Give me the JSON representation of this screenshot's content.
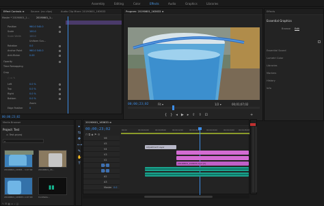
{
  "topnav": {
    "workspaces": [
      {
        "label": "Assembly",
        "active": false
      },
      {
        "label": "Editing",
        "active": false
      },
      {
        "label": "Color",
        "active": false
      },
      {
        "label": "Effects",
        "active": true
      },
      {
        "label": "Audio",
        "active": false
      },
      {
        "label": "Graphics",
        "active": false
      },
      {
        "label": "Libraries",
        "active": false
      }
    ]
  },
  "effect_controls": {
    "tabs": [
      {
        "label": "Effect Controls ≡",
        "active": true
      },
      {
        "label": "Source: (no clips)",
        "active": false
      },
      {
        "label": "Audio Clip Mixer: 20190601_163633",
        "active": false
      }
    ],
    "master_label": "Master * 20190601_1...",
    "sequence_label": "20190601_1...",
    "rows": [
      {
        "label": "Position",
        "value": "960.0   540.0"
      },
      {
        "label": "Scale",
        "value": "100.0"
      },
      {
        "label": "Scale Width",
        "value": "100.0"
      },
      {
        "label": "",
        "value": "Uniform Sca..."
      },
      {
        "label": "Rotation",
        "value": "0.0"
      },
      {
        "label": "Anchor Point",
        "value": "960.0   540.0"
      },
      {
        "label": "Anti-flicker",
        "value": "0.00"
      },
      {
        "label": "Opacity",
        "value": ""
      },
      {
        "label": "Time Remapping",
        "value": ""
      },
      {
        "label": "Crop",
        "value": ""
      },
      {
        "label": "Left",
        "value": "0.0 %"
      },
      {
        "label": "Top",
        "value": "0.0 %"
      },
      {
        "label": "Right",
        "value": "0.0 %"
      },
      {
        "label": "Bottom",
        "value": "0.0 %"
      },
      {
        "label": "",
        "value": "Zoom"
      },
      {
        "label": "Edge Feather",
        "value": "0"
      }
    ],
    "timecode": "00;00;23;02"
  },
  "program": {
    "title": "Program: 20190601_163633 ≡",
    "timecode": "00;00;23;02",
    "fit": "Fit",
    "quality": "1/2",
    "duration": "00;01;07;02"
  },
  "essential_graphics": {
    "tabs": [
      {
        "label": "Effects",
        "active": false
      },
      {
        "label": "Essential Graphics",
        "active": true
      }
    ],
    "subtabs": [
      {
        "label": "Browse",
        "active": false
      },
      {
        "label": "Edit",
        "active": true
      }
    ],
    "sections": [
      "Essential Sound",
      "Lumetri Color",
      "Libraries",
      "Markers",
      "History",
      "Info"
    ]
  },
  "project": {
    "tabs": [
      {
        "label": "Media Browser",
        "active": false
      },
      {
        "label": "Project: Test",
        "active": true
      }
    ],
    "item_count": "Test.prproj",
    "clips": [
      {
        "name": "20190601_16363...",
        "duration": "1;07;02"
      },
      {
        "name": "20190601_16...",
        "duration": "..."
      },
      {
        "name": "20190601_163633...",
        "duration": "1;07;00"
      },
      {
        "name": "Cocktaile...",
        "duration": ""
      }
    ]
  },
  "timeline": {
    "tab": "20190601_163633 ≡",
    "timecode": "00;00;23;02",
    "ruler": [
      "00;00",
      "00;00;04;00",
      "00;00;08;00",
      "00;00;12;00",
      "00;00;16;00",
      "00;00;20;00",
      "00;00;24;00",
      "00;00;28;00"
    ],
    "tracks": [
      {
        "name": "V6",
        "type": "video"
      },
      {
        "name": "V5",
        "type": "video"
      },
      {
        "name": "V4",
        "type": "video"
      },
      {
        "name": "V3",
        "type": "video"
      },
      {
        "name": "V2",
        "type": "video"
      },
      {
        "name": "V1",
        "type": "video"
      },
      {
        "name": "A1",
        "type": "audio"
      },
      {
        "name": "A2",
        "type": "audio"
      },
      {
        "name": "A3",
        "type": "audio"
      },
      {
        "name": "Master",
        "type": "master",
        "value": "0.0"
      }
    ],
    "clips": {
      "adjustment": "Adjustment Layer",
      "video": "20190601_163633.mp4 [V]"
    }
  },
  "tools": [
    "▸",
    "⇆",
    "✥",
    "⟷",
    "✎",
    "✋",
    "T"
  ],
  "colors": {
    "accent": "#3d8ee8",
    "pink_clip": "#d36bd2",
    "teal_audio": "#1aa38d"
  }
}
